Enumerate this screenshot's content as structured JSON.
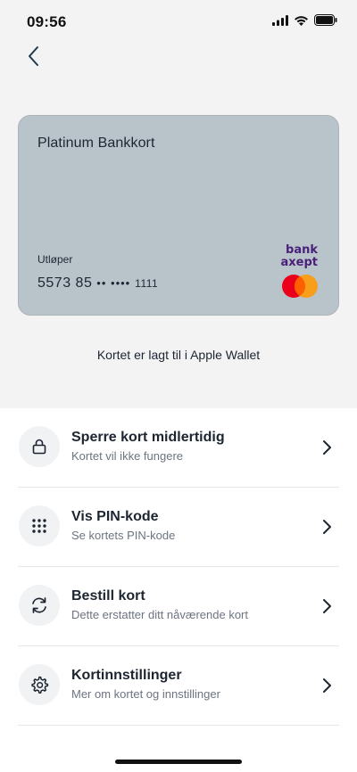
{
  "status_bar": {
    "time": "09:56",
    "icons": [
      "signal-icon",
      "wifi-icon",
      "battery-icon"
    ]
  },
  "nav": {
    "back_icon": "chevron-left-icon"
  },
  "card": {
    "name": "Platinum Bankkort",
    "expiry_label": "Utløper",
    "number_visible": "5573 85",
    "number_masked": "•• ••••",
    "number_last": "1111",
    "brand_logo_text": "bank axept",
    "network": "Mastercard",
    "colors": {
      "background": "#b9c3ca",
      "bankaxept": "#4a1f7a",
      "mc_red": "#eb001b",
      "mc_orange": "#f79e1b"
    }
  },
  "wallet_note": "Kortet er lagt til i Apple Wallet",
  "menu": {
    "items": [
      {
        "icon": "lock-icon",
        "title": "Sperre kort midlertidig",
        "subtitle": "Kortet vil ikke fungere"
      },
      {
        "icon": "keypad-icon",
        "title": "Vis PIN-kode",
        "subtitle": "Se kortets PIN-kode"
      },
      {
        "icon": "refresh-icon",
        "title": "Bestill kort",
        "subtitle": "Dette erstatter ditt nåværende kort"
      },
      {
        "icon": "gear-icon",
        "title": "Kortinnstillinger",
        "subtitle": "Mer om kortet og innstillinger"
      }
    ]
  }
}
